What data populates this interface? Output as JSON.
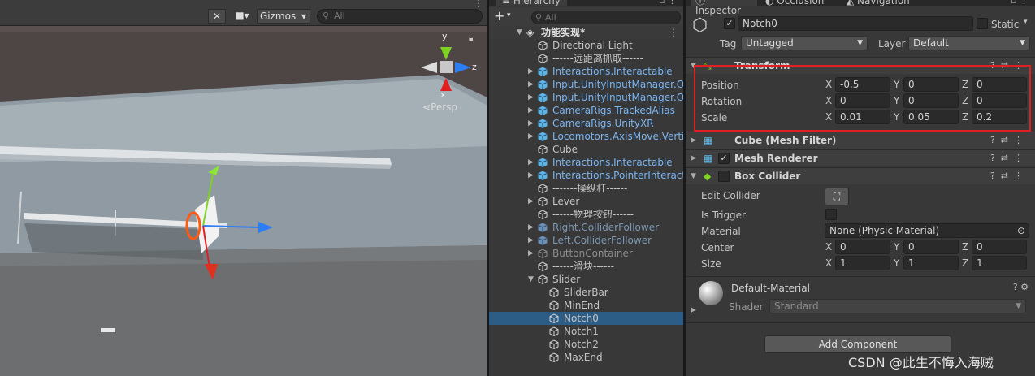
{
  "scene": {
    "tools_icon": "wrench-cross-icon",
    "camera_icon": "camera-icon",
    "gizmos_label": "Gizmos",
    "search_placeholder": "All",
    "axes": {
      "y": "y",
      "x": "x",
      "z": "z"
    },
    "persp_label": "Persp"
  },
  "hierarchy": {
    "tab_label": "Hierarchy",
    "add_label": "+",
    "search_placeholder": "All",
    "root": "功能实现*",
    "items": [
      {
        "label": "Directional Light",
        "style": "normal",
        "prefab": false,
        "fold": false
      },
      {
        "label": "------远距离抓取------",
        "style": "normal",
        "prefab": false,
        "fold": false
      },
      {
        "label": "Interactions.Interactable",
        "style": "blue",
        "prefab": true,
        "fold": true
      },
      {
        "label": "Input.UnityInputManager.Ope",
        "style": "blue",
        "prefab": true,
        "fold": true
      },
      {
        "label": "Input.UnityInputManager.Ope",
        "style": "blue",
        "prefab": true,
        "fold": true
      },
      {
        "label": "CameraRigs.TrackedAlias",
        "style": "blue",
        "prefab": true,
        "fold": true
      },
      {
        "label": "CameraRigs.UnityXR",
        "style": "blue",
        "prefab": true,
        "fold": true
      },
      {
        "label": "Locomotors.AxisMove.Vertica",
        "style": "blue",
        "prefab": true,
        "fold": true
      },
      {
        "label": "Cube",
        "style": "normal",
        "prefab": false,
        "fold": false
      },
      {
        "label": "Interactions.Interactable",
        "style": "blue",
        "prefab": true,
        "fold": true
      },
      {
        "label": "Interactions.PointerInteractor",
        "style": "blue",
        "prefab": true,
        "fold": true
      },
      {
        "label": "-------操纵杆------",
        "style": "normal",
        "prefab": false,
        "fold": false
      },
      {
        "label": "Lever",
        "style": "normal",
        "prefab": false,
        "fold": true
      },
      {
        "label": "------物理按钮------",
        "style": "normal",
        "prefab": false,
        "fold": false
      },
      {
        "label": "Right.ColliderFollower",
        "style": "dim",
        "prefab": true,
        "fold": true
      },
      {
        "label": "Left.ColliderFollower",
        "style": "dim",
        "prefab": true,
        "fold": true
      },
      {
        "label": "ButtonContainer",
        "style": "grey",
        "prefab": false,
        "fold": true
      },
      {
        "label": "------滑块------",
        "style": "normal",
        "prefab": false,
        "fold": false
      },
      {
        "label": "Slider",
        "style": "normal",
        "prefab": false,
        "fold": "open"
      },
      {
        "label": "SliderBar",
        "style": "normal",
        "prefab": false,
        "fold": false,
        "child": true
      },
      {
        "label": "MinEnd",
        "style": "normal",
        "prefab": false,
        "fold": false,
        "child": true
      },
      {
        "label": "Notch0",
        "style": "normal",
        "prefab": false,
        "fold": false,
        "child": true,
        "selected": true
      },
      {
        "label": "Notch1",
        "style": "normal",
        "prefab": false,
        "fold": false,
        "child": true
      },
      {
        "label": "Notch2",
        "style": "normal",
        "prefab": false,
        "fold": false,
        "child": true
      },
      {
        "label": "MaxEnd",
        "style": "normal",
        "prefab": false,
        "fold": false,
        "child": true
      }
    ]
  },
  "inspector": {
    "tabs": [
      "Inspector",
      "Occlusion",
      "Navigation"
    ],
    "object_name": "Notch0",
    "static_label": "Static",
    "tag_label": "Tag",
    "tag_value": "Untagged",
    "layer_label": "Layer",
    "layer_value": "Default",
    "transform": {
      "title": "Transform",
      "rows": [
        {
          "label": "Position",
          "x": "-0.5",
          "y": "0",
          "z": "0"
        },
        {
          "label": "Rotation",
          "x": "0",
          "y": "0",
          "z": "0"
        },
        {
          "label": "Scale",
          "x": "0.01",
          "y": "0.05",
          "z": "0.2"
        }
      ]
    },
    "mesh_filter": {
      "title": "Cube (Mesh Filter)"
    },
    "mesh_renderer": {
      "title": "Mesh Renderer"
    },
    "box_collider": {
      "title": "Box Collider",
      "edit_label": "Edit Collider",
      "trigger_label": "Is Trigger",
      "material_label": "Material",
      "material_value": "None (Physic Material)",
      "center_label": "Center",
      "center": {
        "x": "0",
        "y": "0",
        "z": "0"
      },
      "size_label": "Size",
      "size": {
        "x": "1",
        "y": "1",
        "z": "1"
      }
    },
    "material": {
      "name": "Default-Material",
      "shader_label": "Shader",
      "shader_value": "Standard"
    },
    "add_component_label": "Add Component",
    "axis_labels": {
      "x": "X",
      "y": "Y",
      "z": "Z"
    }
  },
  "watermark": "CSDN @此生不悔入海贼",
  "colors": {
    "highlight": "#e02020",
    "selection": "#2c5d87",
    "prefab": "#7bb6f2"
  }
}
